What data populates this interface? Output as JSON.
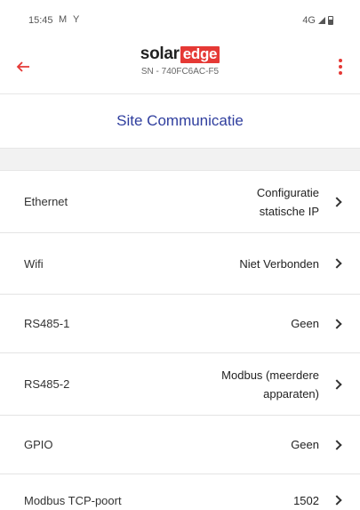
{
  "status_bar": {
    "time": "15:45",
    "left_icons": "M Y",
    "network": "4G"
  },
  "app_bar": {
    "logo_solar": "solar",
    "logo_edge": "edge",
    "serial": "SN - 740FC6AC-F5"
  },
  "page": {
    "title": "Site Communicatie"
  },
  "rows": [
    {
      "label": "Ethernet",
      "value_line1": "Configuratie",
      "value_line2": "statische IP"
    },
    {
      "label": "Wifi",
      "value_line1": "Niet Verbonden",
      "value_line2": ""
    },
    {
      "label": "RS485-1",
      "value_line1": "Geen",
      "value_line2": ""
    },
    {
      "label": "RS485-2",
      "value_line1": "Modbus (meerdere",
      "value_line2": "apparaten)"
    },
    {
      "label": "GPIO",
      "value_line1": "Geen",
      "value_line2": ""
    },
    {
      "label": "Modbus TCP-poort",
      "value_line1": "1502",
      "value_line2": ""
    }
  ],
  "colors": {
    "accent": "#e53935",
    "title": "#2f3e9e"
  }
}
